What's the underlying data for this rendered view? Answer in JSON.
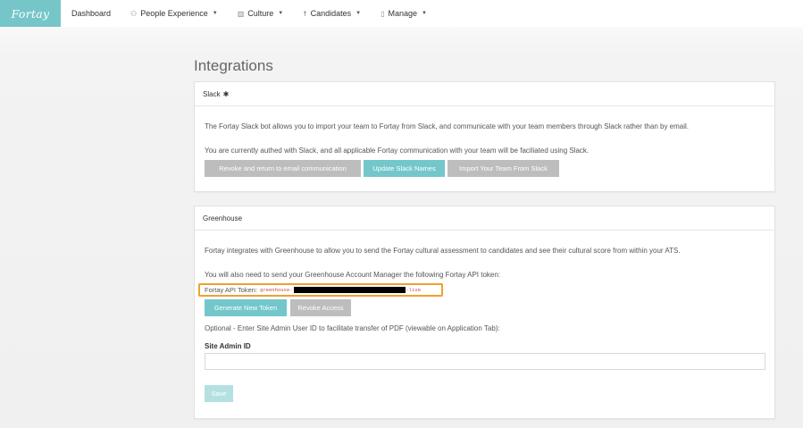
{
  "brand": {
    "logo_text": "Fortay",
    "accent": "#76c6c9"
  },
  "nav": {
    "items": [
      {
        "label": "Dashboard",
        "icon": "",
        "has_caret": false
      },
      {
        "label": "People Experience",
        "icon": "people-icon",
        "has_caret": true
      },
      {
        "label": "Culture",
        "icon": "chart-icon",
        "has_caret": true
      },
      {
        "label": "Candidates",
        "icon": "candidate-icon",
        "has_caret": true
      },
      {
        "label": "Manage",
        "icon": "document-icon",
        "has_caret": true
      }
    ]
  },
  "page": {
    "title": "Integrations"
  },
  "slack": {
    "header": "Slack",
    "header_icon": "slack-icon",
    "description": "The Fortay Slack bot allows you to import your team to Fortay from Slack, and communicate with your team members through Slack rather than by email.",
    "status": "You are currently authed with Slack, and all applicable Fortay communication with your team will be faciliated using Slack.",
    "buttons": {
      "revoke": "Revoke and return to email communication",
      "update": "Update Slack Names",
      "import": "Import Your Team From Slack"
    }
  },
  "greenhouse": {
    "header": "Greenhouse",
    "description": "Fortay integrates with Greenhouse to allow you to send the Fortay cultural assessment to candidates and see their cultural score from within your ATS.",
    "instruction": "You will also need to send your Greenhouse Account Manager the following Fortay API token:",
    "token_label": "Fortay API Token:",
    "token_prefix": "greenhouse-",
    "token_suffix": "-live",
    "buttons": {
      "generate": "Generate New Token",
      "revoke": "Revoke Access",
      "save": "Save"
    },
    "optional_text": "Optional - Enter Site Admin User ID to facilitate transfer of PDF (viewable on Application Tab):",
    "site_admin_label": "Site Admin ID",
    "site_admin_value": "",
    "highlight_color": "#f0a02e"
  }
}
